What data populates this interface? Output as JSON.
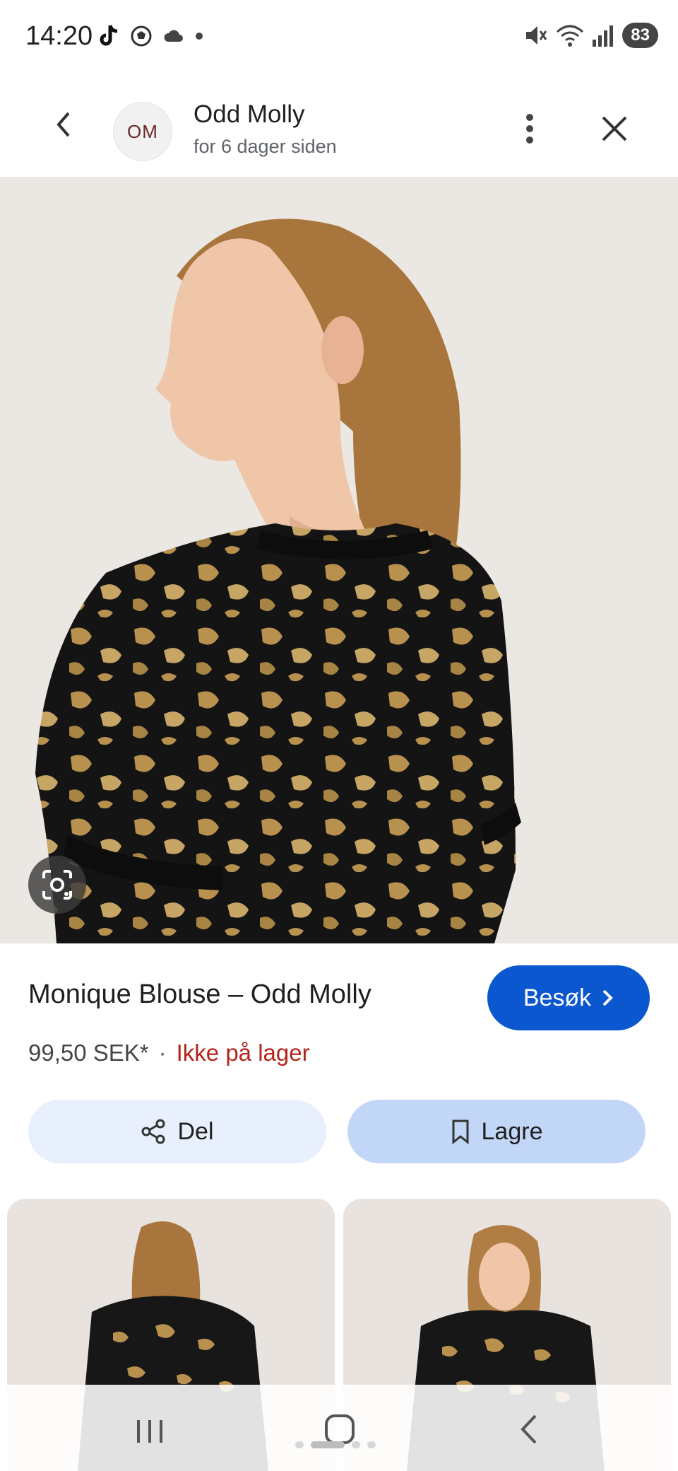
{
  "status_bar": {
    "time": "14:20",
    "battery": "83",
    "left_icons": [
      "tiktok-icon",
      "soccer-icon",
      "cloud-icon",
      "dot-icon"
    ],
    "right_icons": [
      "mute-icon",
      "wifi-icon",
      "signal-icon",
      "battery-icon"
    ]
  },
  "header": {
    "logo_text": "OM",
    "site_name": "Odd Molly",
    "time_ago": "for 6 dager siden"
  },
  "product": {
    "title": "Monique Blouse – Odd Molly",
    "visit_label": "Besøk",
    "price": "99,50 SEK*",
    "separator": "·",
    "stock_status": "Ikke på lager"
  },
  "actions": {
    "share_label": "Del",
    "save_label": "Lagre"
  },
  "colors": {
    "accent": "#0b57d0",
    "stock_red": "#b3261e",
    "share_bg": "#e8f0fe",
    "save_bg": "#c2d7f7"
  }
}
